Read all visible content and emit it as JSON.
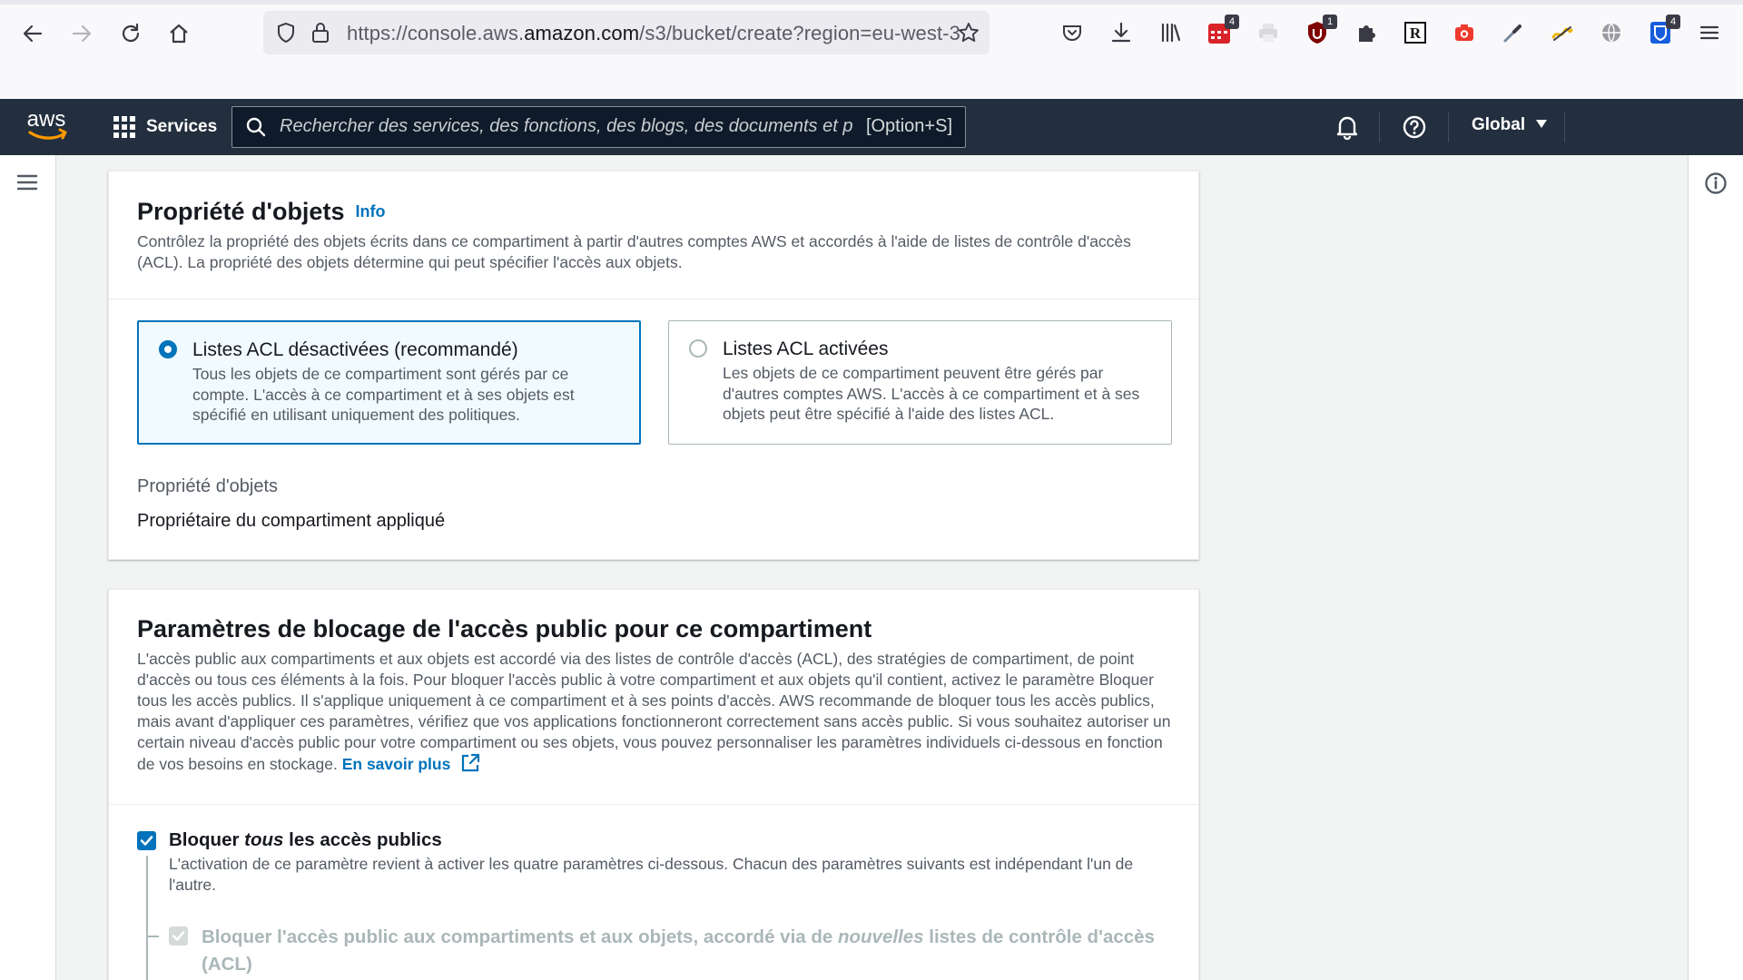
{
  "browser": {
    "url_prefix": "https://console.aws.",
    "url_domain": "amazon.com",
    "url_suffix": "/s3/bucket/create?region=eu-west-3",
    "badges": {
      "calendar": "4",
      "ublock": "1",
      "bitwarden": "4"
    }
  },
  "aws_nav": {
    "logo_text": "aws",
    "services_label": "Services",
    "search_placeholder": "Rechercher des services, des fonctions, des blogs, des documents et p",
    "search_shortcut": "[Option+S]",
    "region_label": "Global"
  },
  "object_ownership": {
    "title": "Propriété d'objets",
    "info_label": "Info",
    "description": "Contrôlez la propriété des objets écrits dans ce compartiment à partir d'autres comptes AWS et accordés à l'aide de listes de contrôle d'accès (ACL). La propriété des objets détermine qui peut spécifier l'accès aux objets.",
    "options": [
      {
        "title": "Listes ACL désactivées (recommandé)",
        "description": "Tous les objets de ce compartiment sont gérés par ce compte. L'accès à ce compartiment et à ses objets est spécifié en utilisant uniquement des politiques.",
        "selected": true
      },
      {
        "title": "Listes ACL activées",
        "description": "Les objets de ce compartiment peuvent être gérés par d'autres comptes AWS. L'accès à ce compartiment et à ses objets peut être spécifié à l'aide des listes ACL.",
        "selected": false
      }
    ],
    "field_label": "Propriété d'objets",
    "field_value": "Propriétaire du compartiment appliqué"
  },
  "public_access": {
    "title": "Paramètres de blocage de l'accès public pour ce compartiment",
    "description": "L'accès public aux compartiments et aux objets est accordé via des listes de contrôle d'accès (ACL), des stratégies de compartiment, de point d'accès ou tous ces éléments à la fois. Pour bloquer l'accès public à votre compartiment et aux objets qu'il contient, activez le paramètre Bloquer tous les accès publics. Il s'applique uniquement à ce compartiment et à ses points d'accès. AWS recommande de bloquer tous les accès publics, mais avant d'appliquer ces paramètres, vérifiez que vos applications fonctionneront correctement sans accès public. Si vous souhaitez autoriser un certain niveau d'accès public pour votre compartiment ou ses objets, vous pouvez personnaliser les paramètres individuels ci-dessous en fonction de vos besoins en stockage.",
    "learn_more": "En savoir plus",
    "block_all": {
      "label_pre": "Bloquer ",
      "label_em": "tous",
      "label_post": " les accès publics",
      "checked": true,
      "description": "L'activation de ce paramètre revient à activer les quatre paramètres ci-dessous. Chacun des paramètres suivants est indépendant l'un de l'autre."
    },
    "sub_option": {
      "label_pre": "Bloquer l'accès public aux compartiments et aux objets, accordé via de ",
      "label_em": "nouvelles",
      "label_post": " listes de contrôle d'accès",
      "label_line2": "(ACL)",
      "checked": true,
      "disabled": true
    }
  },
  "colors": {
    "aws_nav_bg": "#232f3e",
    "accent_blue": "#0073bb",
    "aws_orange": "#ff9900"
  }
}
